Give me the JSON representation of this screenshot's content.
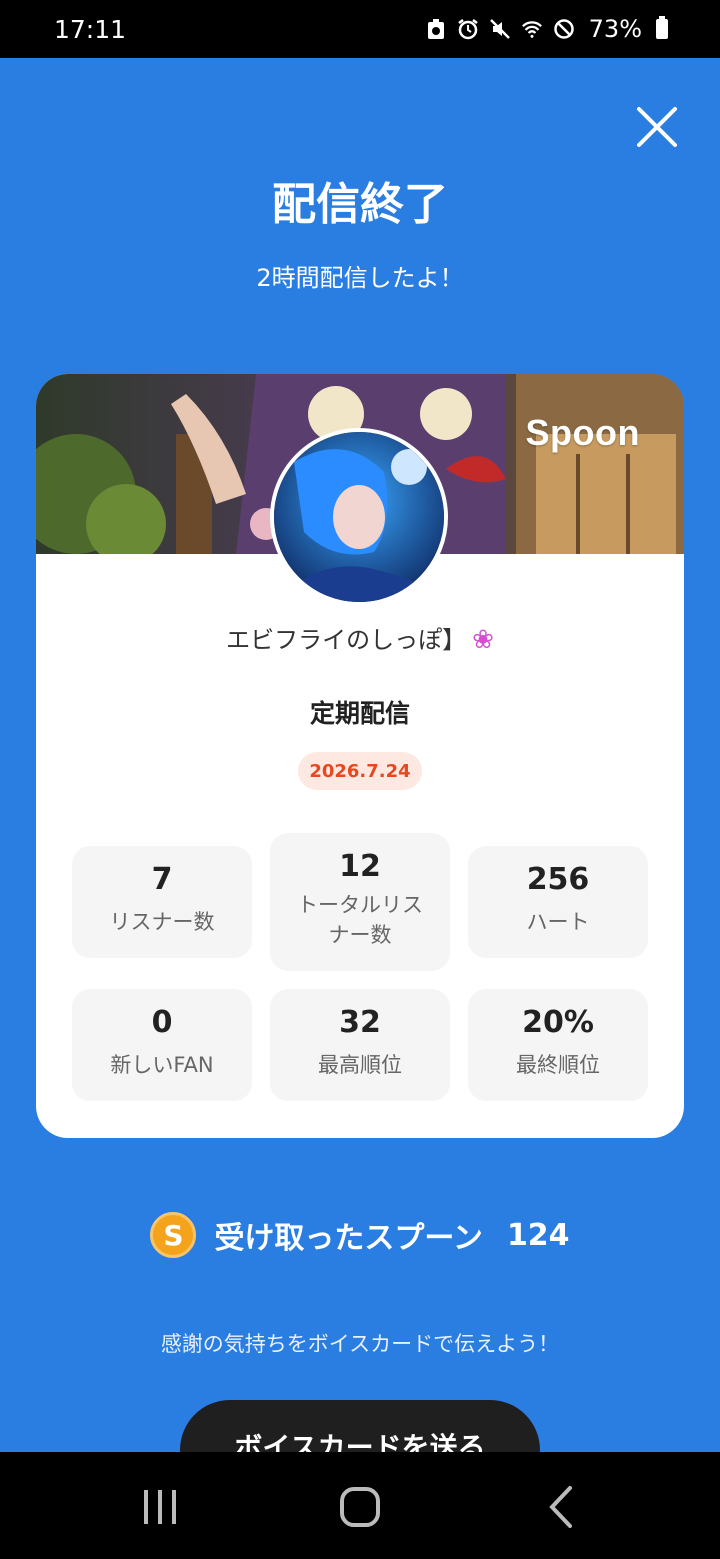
{
  "status_bar": {
    "time": "17:11",
    "battery": "73%",
    "icons": [
      "recycle-icon",
      "alarm-icon",
      "mute-icon",
      "wifi-icon",
      "dnd-icon",
      "battery-icon"
    ]
  },
  "header": {
    "title": "配信終了",
    "subtitle": "2時間配信したよ！"
  },
  "card": {
    "brand": "Spoon",
    "username": "エビフライのしっぽ】",
    "username_emoji": "❀",
    "broadcast_title": "定期配信",
    "date": "2026.7.24",
    "stats": [
      {
        "value": "7",
        "label": "リスナー数"
      },
      {
        "value": "12",
        "label_line1": "トータルリス",
        "label_line2": "ナー数"
      },
      {
        "value": "256",
        "label": "ハート"
      },
      {
        "value": "0",
        "label": "新しいFAN"
      },
      {
        "value": "32",
        "label": "最高順位"
      },
      {
        "value": "20%",
        "label": "最終順位"
      }
    ]
  },
  "spoons": {
    "coin_symbol": "S",
    "label": "受け取ったスプーン",
    "count": "124"
  },
  "thanks_text": "感謝の気持ちをボイスカードで伝えよう！",
  "voice_card_button": "ボイスカードを送る",
  "colors": {
    "background": "#2a7de1",
    "date_badge_bg": "#fde8e2",
    "date_badge_text": "#e8481d",
    "coin": "#f5a31a"
  }
}
